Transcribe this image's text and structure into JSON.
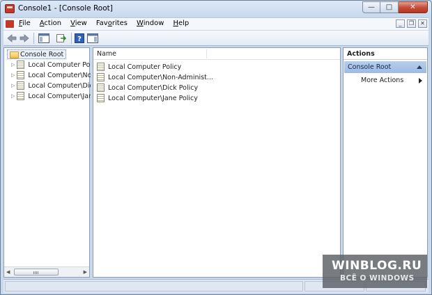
{
  "window": {
    "title": "Console1 - [Console Root]"
  },
  "caption_buttons": {
    "minimize": "—",
    "maximize": "□",
    "close": "✕"
  },
  "menubar": {
    "items": [
      {
        "label": "File",
        "mnemonic": "F",
        "rest": "ile"
      },
      {
        "label": "Action",
        "mnemonic": "A",
        "rest": "ction"
      },
      {
        "label": "View",
        "mnemonic": "V",
        "rest": "iew"
      },
      {
        "label": "Favorites",
        "pre": "Fav",
        "mnemonic": "o",
        "rest": "rites"
      },
      {
        "label": "Window",
        "mnemonic": "W",
        "rest": "indow"
      },
      {
        "label": "Help",
        "mnemonic": "H",
        "rest": "elp"
      }
    ],
    "mdi": {
      "minimize": "_",
      "restore": "❐",
      "close": "✕"
    }
  },
  "toolbar": {
    "icons": [
      "back-icon",
      "forward-icon",
      "show-hide-tree-icon",
      "export-list-icon",
      "help-icon",
      "show-hide-action-pane-icon"
    ]
  },
  "tree": {
    "root": "Console Root",
    "items": [
      "Local Computer Pol",
      "Local Computer\\No",
      "Local Computer\\Dic",
      "Local Computer\\Jan"
    ]
  },
  "list": {
    "column": "Name",
    "items": [
      "Local Computer Policy",
      "Local Computer\\Non-Administ...",
      "Local Computer\\Dick Policy",
      "Local Computer\\Jane Policy"
    ]
  },
  "actions": {
    "header": "Actions",
    "group": "Console Root",
    "more": "More Actions"
  },
  "watermark": {
    "title": "WINBLOG.RU",
    "subtitle": "ВСЁ О WINDOWS"
  }
}
